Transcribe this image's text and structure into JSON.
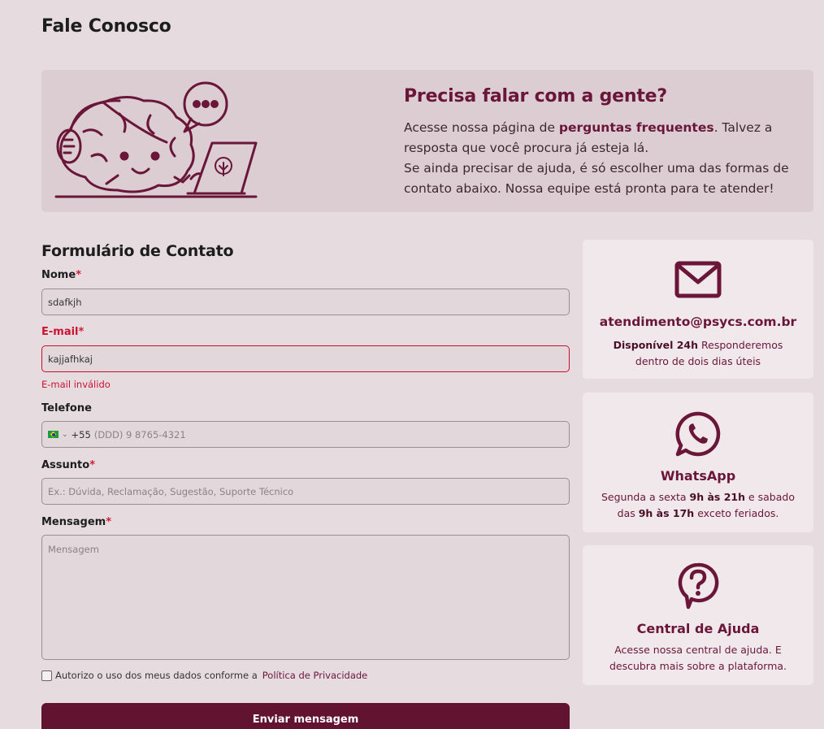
{
  "page": {
    "title": "Fale Conosco"
  },
  "banner": {
    "heading": "Precisa falar com a gente?",
    "line1_pre": "Acesse nossa página de ",
    "line1_link": "perguntas frequentes",
    "line1_post": ". Talvez a resposta que você procura já esteja lá.",
    "line2": "Se ainda precisar de ajuda, é só escolher uma das formas de contato abaixo. Nossa equipe está pronta para te atender!"
  },
  "form": {
    "title": "Formulário de Contato",
    "required_mark": "*",
    "nome": {
      "label": "Nome",
      "value": "sdafkjh"
    },
    "email": {
      "label": "E-mail",
      "value": "kajjafhkaj",
      "error": "E-mail inválido"
    },
    "telefone": {
      "label": "Telefone",
      "dial_code": "+55",
      "placeholder": "(DDD) 9 8765-4321"
    },
    "assunto": {
      "label": "Assunto",
      "placeholder": "Ex.: Dúvida, Reclamação, Sugestão, Suporte Técnico"
    },
    "mensagem": {
      "label": "Mensagem",
      "placeholder": "Mensagem"
    },
    "consent_text": "Autorizo o uso dos meus dados conforme a",
    "consent_link": "Política de Privacidade",
    "submit_label": "Enviar mensagem"
  },
  "cards": {
    "email": {
      "icon": "envelope-icon",
      "title": "atendimento@psycs.com.br",
      "desc_bold": "Disponível 24h",
      "desc_rest": " Responderemos dentro de dois dias úteis"
    },
    "whatsapp": {
      "icon": "whatsapp-icon",
      "title": "WhatsApp",
      "desc_a": "Segunda a sexta ",
      "desc_b": "9h às 21h",
      "desc_c": " e sabado das ",
      "desc_d": "9h às 17h",
      "desc_e": " exceto feriados."
    },
    "help": {
      "icon": "help-bubble-icon",
      "title": "Central de Ajuda",
      "desc": "Acesse nossa central de ajuda. E descubra mais sobre a plataforma."
    }
  },
  "colors": {
    "background": "#e6dce0",
    "banner_bg": "#dccdd2",
    "brand": "#6a1638",
    "button": "#62132f",
    "error": "#cc1132",
    "card_bg": "#f1e8eb"
  }
}
